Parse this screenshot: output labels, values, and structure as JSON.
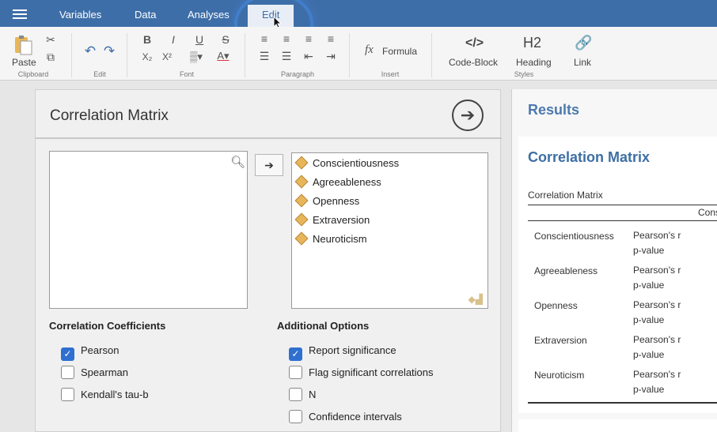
{
  "menu": {
    "tabs": [
      {
        "label": "Variables"
      },
      {
        "label": "Data"
      },
      {
        "label": "Analyses"
      },
      {
        "label": "Edit"
      }
    ]
  },
  "ribbon": {
    "clipboard": {
      "paste": "Paste",
      "label": "Clipboard"
    },
    "edit": {
      "label": "Edit"
    },
    "font": {
      "label": "Font",
      "bold": "B",
      "italic": "I",
      "underline": "U",
      "strike": "S",
      "subscript": "X₂",
      "superscript": "X²"
    },
    "paragraph": {
      "label": "Paragraph"
    },
    "insert": {
      "formula": "Formula",
      "label": "Insert",
      "fx": "fx"
    },
    "styles": {
      "code_block": "Code-Block",
      "heading": "Heading",
      "link": "Link",
      "label": "Styles",
      "h2": "H2",
      "code_glyph": "</>"
    }
  },
  "panel": {
    "title": "Correlation Matrix",
    "selected_vars": [
      "Conscientiousness",
      "Agreeableness",
      "Openness",
      "Extraversion",
      "Neuroticism"
    ],
    "coefficients": {
      "label": "Correlation Coefficients",
      "options": [
        {
          "label": "Pearson",
          "checked": true
        },
        {
          "label": "Spearman",
          "checked": false
        },
        {
          "label": "Kendall's tau-b",
          "checked": false
        }
      ]
    },
    "additional": {
      "label": "Additional Options",
      "options": [
        {
          "label": "Report significance",
          "checked": true
        },
        {
          "label": "Flag significant correlations",
          "checked": false
        },
        {
          "label": "N",
          "checked": false
        },
        {
          "label": "Confidence intervals",
          "checked": false
        }
      ]
    }
  },
  "results": {
    "header": "Results",
    "title": "Correlation Matrix",
    "subtitle": "Correlation Matrix",
    "column_head": "Cons",
    "rows": [
      {
        "name": "Conscientiousness",
        "stat1": "Pearson's r",
        "stat2": "p-value"
      },
      {
        "name": "Agreeableness",
        "stat1": "Pearson's r",
        "stat2": "p-value"
      },
      {
        "name": "Openness",
        "stat1": "Pearson's r",
        "stat2": "p-value"
      },
      {
        "name": "Extraversion",
        "stat1": "Pearson's r",
        "stat2": "p-value"
      },
      {
        "name": "Neuroticism",
        "stat1": "Pearson's r",
        "stat2": "p-value"
      }
    ]
  },
  "colors": {
    "menubar": "#3e6ea8",
    "accent": "#2f6fd0",
    "results_title": "#3d6fa4"
  }
}
